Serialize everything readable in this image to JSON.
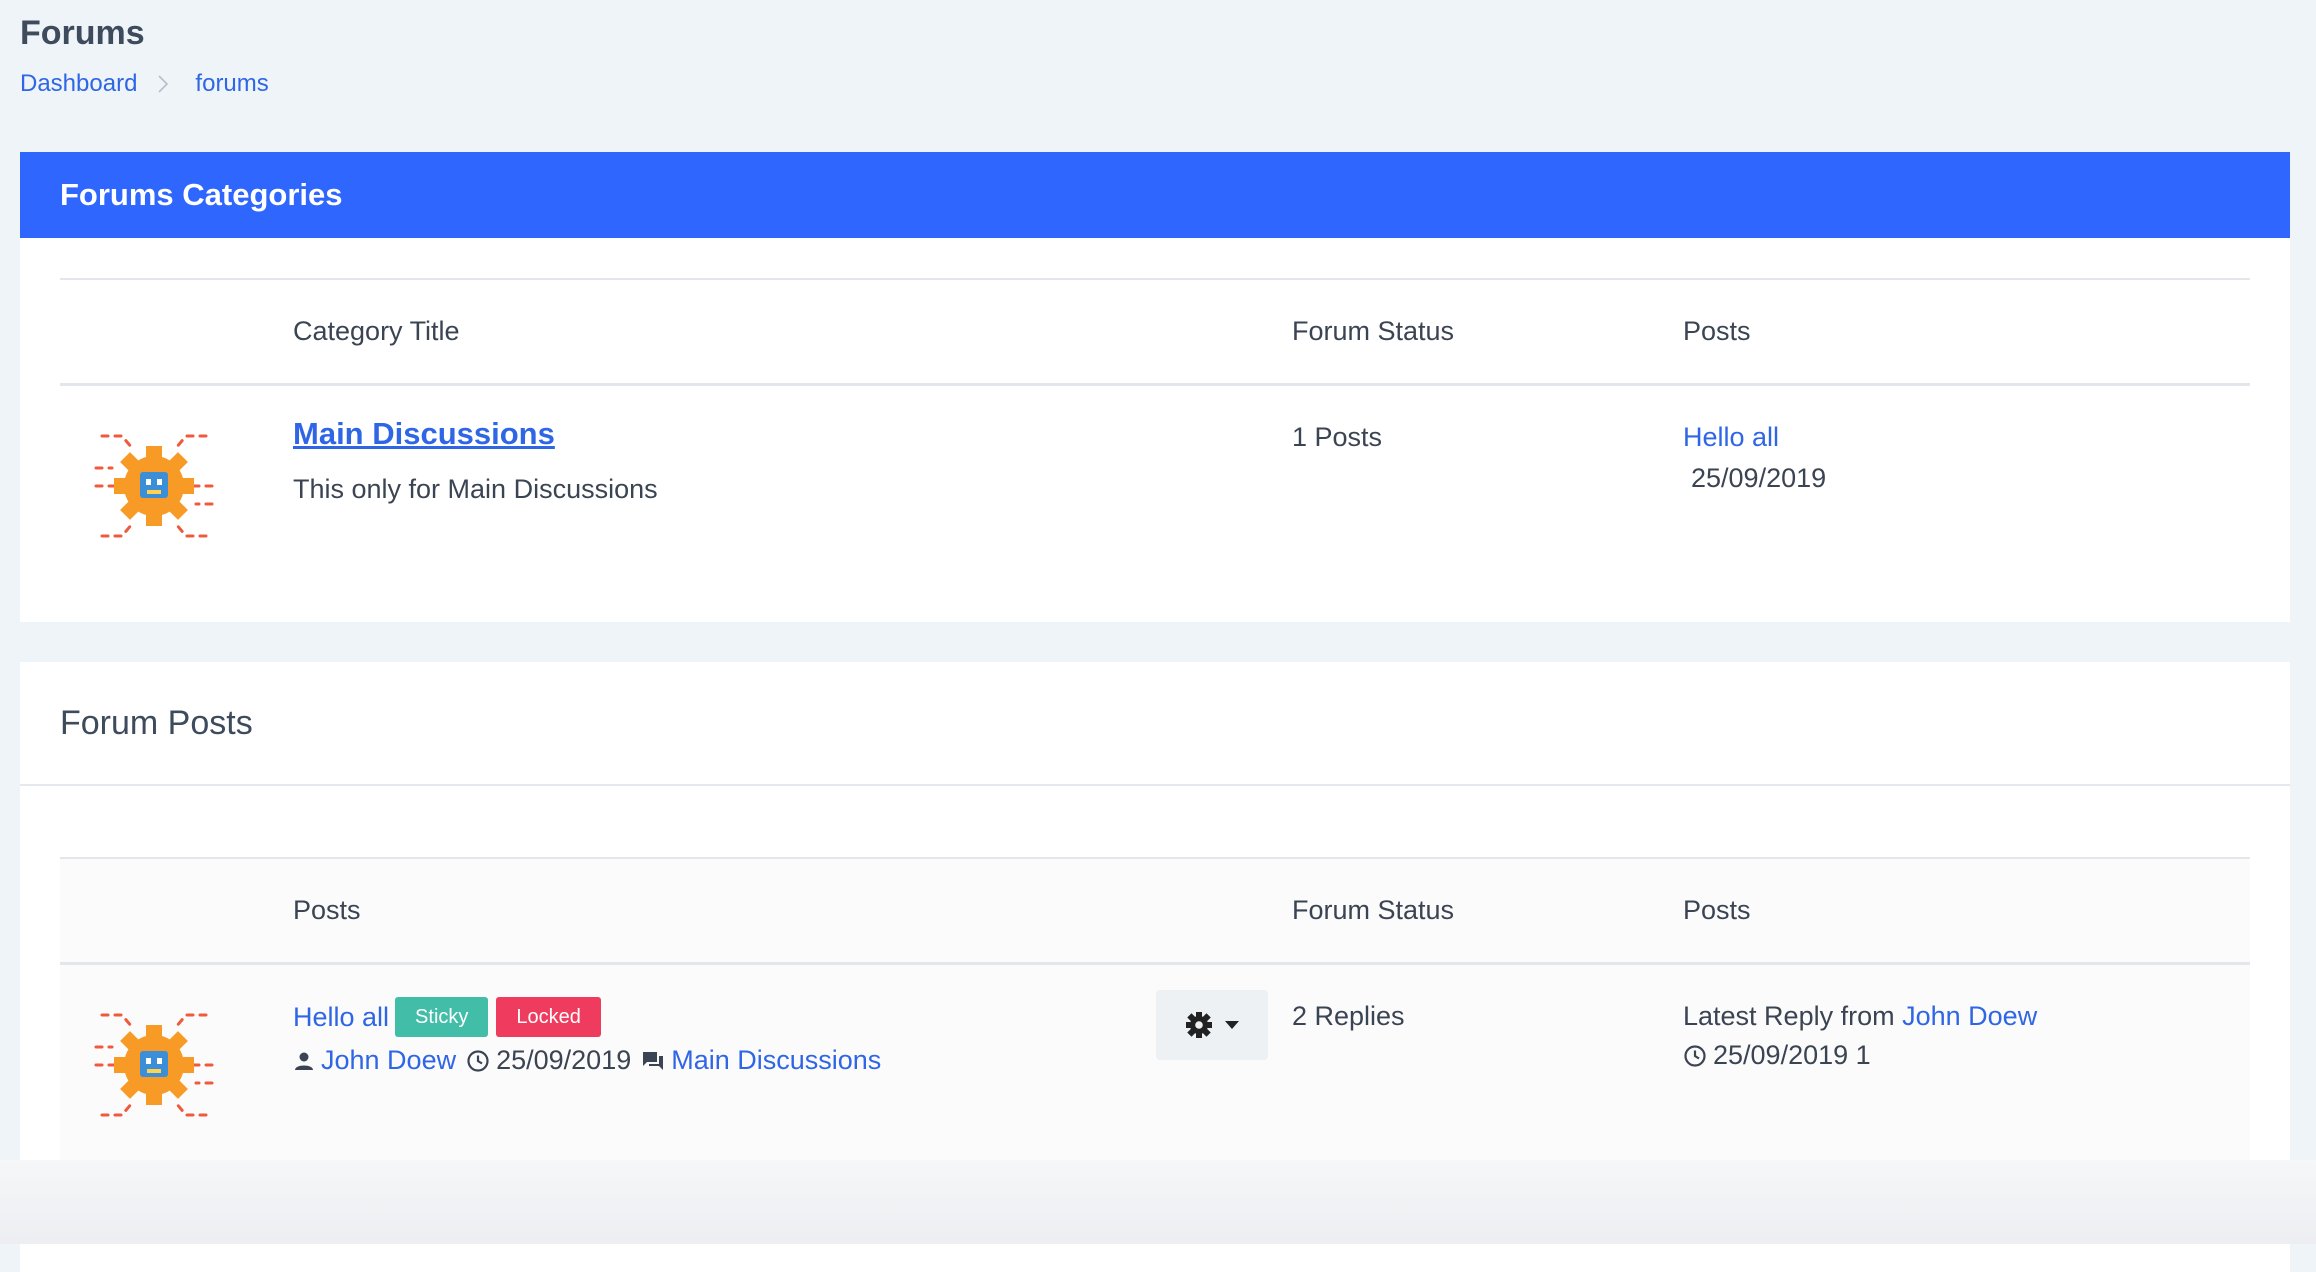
{
  "page": {
    "title": "Forums"
  },
  "breadcrumb": {
    "items": [
      "Dashboard",
      "forums"
    ]
  },
  "categories_card": {
    "title": "Forums Categories",
    "columns": [
      "Category Title",
      "Forum Status",
      "Posts"
    ],
    "rows": [
      {
        "icon": "gear-robot-icon",
        "title": "Main Discussions",
        "description": "This only for Main Discussions",
        "status": "1 Posts",
        "latest_post": "Hello all",
        "latest_date": "25/09/2019"
      }
    ]
  },
  "posts_card": {
    "title": "Forum Posts",
    "columns": [
      "Posts",
      "Forum Status",
      "Posts"
    ],
    "rows": [
      {
        "icon": "gear-robot-icon",
        "title": "Hello all",
        "badges": [
          "Sticky",
          "Locked"
        ],
        "author": "John Doew",
        "date": "25/09/2019",
        "category": "Main Discussions",
        "status": "2 Replies",
        "latest_reply_prefix": "Latest Reply from",
        "latest_reply_author": "John Doew",
        "latest_reply_date": "25/09/2019 1"
      }
    ]
  },
  "colors": {
    "primary": "#2f66fd",
    "link": "#2f66e6",
    "sticky": "#42bda8",
    "locked": "#ef3b5d"
  }
}
